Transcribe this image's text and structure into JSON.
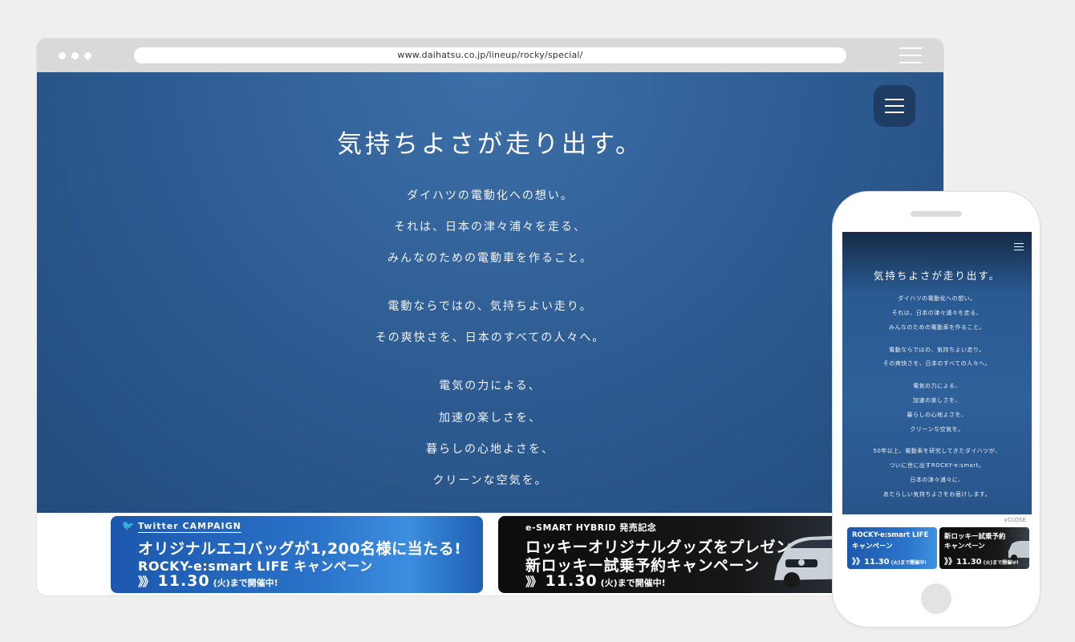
{
  "browser": {
    "url": "www.daihatsu.co.jp/lineup/rocky/special/"
  },
  "hero": {
    "title": "気持ちよさが走り出す。",
    "lines": [
      "ダイハツの電動化への想い。",
      "それは、日本の津々浦々を走る、",
      "みんなのための電動車を作ること。",
      "電動ならではの、気持ちよい走り。",
      "その爽快さを、日本のすべての人々へ。",
      "電気の力による、",
      "加速の楽しさを、",
      "暮らしの心地よさを、",
      "クリーンな空気を。"
    ]
  },
  "banners": {
    "twitter": {
      "tag": "Twitter CAMPAIGN",
      "line1": "オリジナルエコバッグが1,200名様に当たる!",
      "line2": "ROCKY-e:smart LIFE キャンペーン",
      "arrows": "》》",
      "date": "11.30",
      "date_suffix": "(火)まで開催中!"
    },
    "hybrid": {
      "tag": "e-SMART HYBRID 発売記念",
      "line1": "ロッキーオリジナルグッズをプレゼント",
      "line2": "新ロッキー試乗予約キャンペーン",
      "arrows": "》》",
      "date": "11.30",
      "date_suffix": "(火)まで開催中!"
    }
  },
  "mobile": {
    "title": "気持ちよさが走り出す。",
    "lines": [
      "ダイハツの電動化への想い。",
      "それは、日本の津々浦々を走る、",
      "みんなのための電動車を作ること。",
      "電動ならではの、気持ちよい走り。",
      "その爽快さを、日本のすべての人々へ。",
      "電気の力による、",
      "加速の楽しさを、",
      "暮らしの心地よさを、",
      "クリーンな空気を。",
      "50年以上、電動車を研究してきたダイハツが、",
      "ついに世に出すROCKY-e:smart。",
      "日本の津々浦々に、",
      "あたらしい気持ちよさをお届けします。"
    ],
    "close_label": "∨CLOSE",
    "banner1": {
      "line1": "ROCKY-e:smart LIFE",
      "line2": "キャンペーン",
      "date": "》》11.30",
      "date_suffix": "(火)まで開催中!"
    },
    "banner2": {
      "line1": "新ロッキー試乗予約",
      "line2": "キャンペーン",
      "date": "》》11.30",
      "date_suffix": "(火)まで開催中!"
    }
  },
  "icons": {
    "twitter": "twitter-bird-icon",
    "menu": "hamburger-menu-icon",
    "car": "car-photo-icon"
  }
}
